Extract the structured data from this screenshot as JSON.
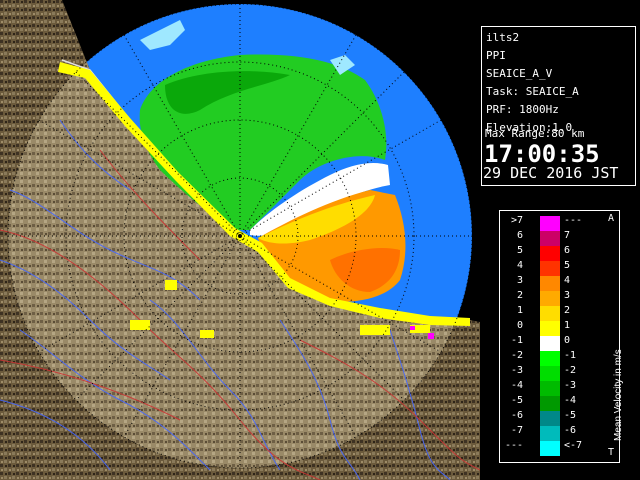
{
  "info": {
    "station": "ilts2",
    "mode": "PPI",
    "product": "SEAICE_A_V",
    "task": "Task: SEAICE_A",
    "prf": "PRF: 1800Hz",
    "elevation": "Elevation:1.0",
    "max_range": "Max Range:80 km",
    "time": "17:00:35",
    "date": "29 DEC 2016 JST"
  },
  "legend": {
    "title": "Mean Velocity in m/s",
    "corner_top": "A",
    "corner_bottom": "T",
    "rows": [
      {
        "left": ">7",
        "right": "---",
        "color": "#ff00ff"
      },
      {
        "left": "6",
        "right": "7",
        "color": "#cc0066"
      },
      {
        "left": "5",
        "right": "6",
        "color": "#ff0000"
      },
      {
        "left": "4",
        "right": "5",
        "color": "#ff3300"
      },
      {
        "left": "3",
        "right": "4",
        "color": "#ff8800"
      },
      {
        "left": "2",
        "right": "3",
        "color": "#ffaa00"
      },
      {
        "left": "1",
        "right": "2",
        "color": "#ffdd00"
      },
      {
        "left": "0",
        "right": "1",
        "color": "#ffff00"
      },
      {
        "left": "-1",
        "right": "0",
        "color": "#ffffff"
      },
      {
        "left": "-2",
        "right": "-1",
        "color": "#00ff00"
      },
      {
        "left": "-3",
        "right": "-2",
        "color": "#00dd00"
      },
      {
        "left": "-4",
        "right": "-3",
        "color": "#00bb00"
      },
      {
        "left": "-5",
        "right": "-4",
        "color": "#009900"
      },
      {
        "left": "-6",
        "right": "-5",
        "color": "#008888"
      },
      {
        "left": "-7",
        "right": "-6",
        "color": "#00bbbb"
      },
      {
        "left": "---",
        "right": "<-7",
        "color": "#00ffff"
      }
    ]
  },
  "colors": {
    "sea_range": "#1e7fff",
    "land": "#6b5a3c",
    "range_ring": "#000000",
    "velocity_negative": "#22cc22",
    "velocity_positive": "#ff9900",
    "rivers": "#4466ff",
    "roads": "#cc3333"
  }
}
